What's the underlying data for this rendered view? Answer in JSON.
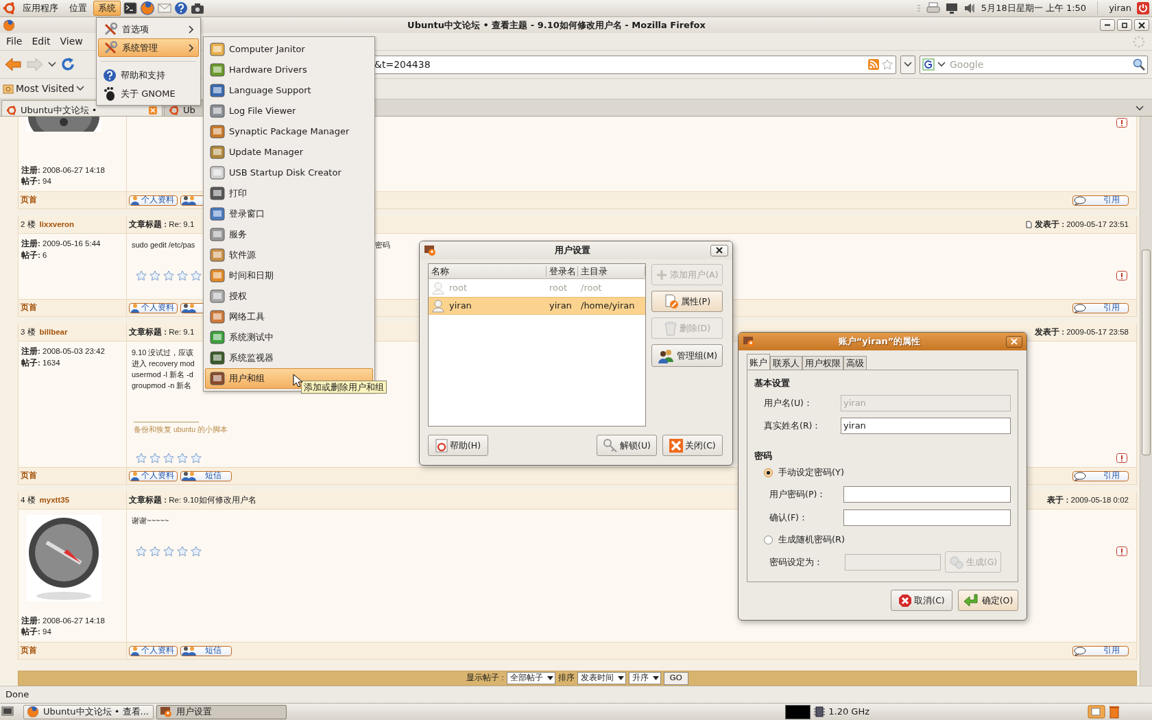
{
  "top_panel": {
    "menus": [
      {
        "label": "应用程序",
        "selected": false
      },
      {
        "label": "位置",
        "selected": false
      },
      {
        "label": "系统",
        "selected": true
      }
    ],
    "clock": "5月18日星期一 上午 1:50",
    "user": "yiran"
  },
  "browser": {
    "title": "Ubuntu中文论坛 • 查看主题 - 9.10如何修改用户名 - Mozilla Firefox",
    "menus": [
      "File",
      "Edit",
      "View"
    ],
    "url": "&t=204438",
    "search": {
      "placeholder": "Google"
    },
    "bookmarks": [
      "Most Visited"
    ],
    "tabs": [
      {
        "label": "Ubuntu中文论坛 •",
        "selected": true
      },
      {
        "label": "Ub",
        "selected": false
      }
    ],
    "status": "Done"
  },
  "forum": {
    "posts": [
      {
        "avatar": {
          "kind": "cut"
        },
        "registered": "**注册:** 2008-06-27 14:18",
        "count": "**帖子:** 94",
        "report": true,
        "footer": {
          "top_link": "页首",
          "buttons": [
            {
              "kind": "profile",
              "label": "个人资料"
            },
            {
              "kind": "pm"
            }
          ],
          "quote": "引用"
        }
      },
      {
        "header": {
          "floor": "2 楼",
          "author": "lixxveron",
          "subject": "**文章标题 :** Re: 9.1",
          "posted": "**发表于 :** 2009-05-17 23:51",
          "posted_icon": true
        },
        "registered": "**注册:** 2009-05-16 5:44",
        "count": "**帖子:** 6",
        "lines": [
          [
            "sudo gedit /etc/pas",
            "密码"
          ]
        ],
        "stars": 0,
        "report": true,
        "footer": {
          "top_link": "页首",
          "buttons": [
            {
              "kind": "profile",
              "label": "个人资料"
            },
            {
              "kind": "pm"
            }
          ],
          "quote": "引用"
        }
      },
      {
        "header": {
          "floor": "3 楼",
          "author": "billbear",
          "subject": "**文章标题 :** Re: 9.1",
          "posted": "**发表于 :** 2009-05-17 23:58",
          "posted_icon": false
        },
        "registered": "**注册:** 2008-05-03 23:42",
        "count": "**帖子:** 1634",
        "lines": [
          [
            "9.10 没试过，应该"
          ],
          [
            "进入 recovery mod"
          ],
          [
            "usermod -l 新名 -d"
          ],
          [
            "groupmod -n 新名"
          ]
        ],
        "signature": "备份和恢复 ubuntu 的小脚本",
        "stars": 0,
        "report": true,
        "footer": {
          "top_link": "页首",
          "buttons": [
            {
              "kind": "profile",
              "label": "个人资料"
            },
            {
              "kind": "pm",
              "label": "短信"
            }
          ],
          "quote": "引用"
        }
      },
      {
        "header": {
          "floor": "4 楼",
          "author": "myxtt35",
          "subject": "**文章标题 :** Re: 9.10如何修改用户名",
          "posted": "**表于 :** 2009-05-18 0:02",
          "posted_icon": false
        },
        "avatar": {
          "kind": "full"
        },
        "registered": "**注册:** 2008-06-27 14:18",
        "count": "**帖子:** 94",
        "lines": [
          [
            "谢谢~~~~~"
          ]
        ],
        "stars": 0,
        "report": true,
        "footer": {
          "top_link": "页首",
          "buttons": [
            {
              "kind": "profile",
              "label": "个人资料"
            },
            {
              "kind": "pm",
              "label": "短信"
            }
          ],
          "quote": "引用"
        }
      }
    ],
    "toolbar": {
      "show_label": "显示帖子 :",
      "show_value": "全部帖子",
      "sort_label": "排序",
      "sort_value": "发表时间",
      "order_value": "升序",
      "go": "GO"
    }
  },
  "system_menu": {
    "items": [
      {
        "kind": "item",
        "label": "首选项",
        "submenu": true,
        "selected": false
      },
      {
        "kind": "item",
        "label": "系统管理",
        "submenu": true,
        "selected": true
      },
      {
        "kind": "separator"
      },
      {
        "kind": "item",
        "label": "帮助和支持",
        "submenu": false,
        "selected": false
      },
      {
        "kind": "item",
        "label": "关于 GNOME",
        "submenu": false,
        "selected": false
      }
    ]
  },
  "admin_menu": {
    "items": [
      {
        "label": "Computer Janitor",
        "selected": false
      },
      {
        "label": "Hardware Drivers",
        "selected": false
      },
      {
        "label": "Language Support",
        "selected": false
      },
      {
        "label": "Log File Viewer",
        "selected": false
      },
      {
        "label": "Synaptic Package Manager",
        "selected": false
      },
      {
        "label": "Update Manager",
        "selected": false
      },
      {
        "label": "USB Startup Disk Creator",
        "selected": false
      },
      {
        "label": "打印",
        "selected": false
      },
      {
        "label": "登录窗口",
        "selected": false
      },
      {
        "label": "服务",
        "selected": false
      },
      {
        "label": "软件源",
        "selected": false
      },
      {
        "label": "时间和日期",
        "selected": false
      },
      {
        "label": "授权",
        "selected": false
      },
      {
        "label": "网络工具",
        "selected": false
      },
      {
        "label": "系统测试中",
        "selected": false
      },
      {
        "label": "系统监视器",
        "selected": false
      },
      {
        "label": "用户和组",
        "selected": true
      }
    ],
    "tooltip": "添加或删除用户和组"
  },
  "users_dialog": {
    "title": "用户设置",
    "columns": [
      "名称",
      "登录名",
      "主目录"
    ],
    "rows": [
      {
        "name": "root",
        "login": "root",
        "home": "/root",
        "disabled": true,
        "selected": false
      },
      {
        "name": "yiran",
        "login": "yiran",
        "home": "/home/yiran",
        "disabled": false,
        "selected": true
      }
    ],
    "side_buttons": [
      {
        "label": "添加用户(A)",
        "disabled": true
      },
      {
        "label": "属性(P)",
        "disabled": false
      },
      {
        "label": "删除(D)",
        "disabled": true
      },
      {
        "label": "管理组(M)",
        "disabled": false
      }
    ],
    "help": "帮助(H)",
    "unlock": "解锁(U)",
    "close": "关闭(C)"
  },
  "properties_dialog": {
    "title": "账户“yiran”的属性",
    "tabs": [
      {
        "label": "账户",
        "selected": true
      },
      {
        "label": "联系人",
        "selected": false
      },
      {
        "label": "用户权限",
        "selected": false
      },
      {
        "label": "高级",
        "selected": false
      }
    ],
    "basic_heading": "基本设置",
    "username": {
      "label": "用户名(U)：",
      "value": "yiran",
      "disabled": true
    },
    "realname": {
      "label": "真实姓名(R)：",
      "value": "yiran",
      "disabled": false
    },
    "password_heading": "密码",
    "manual": {
      "label": "手动设定密码(Y)",
      "checked": true
    },
    "password": {
      "label": "用户密码(P)："
    },
    "confirm": {
      "label": "确认(F)："
    },
    "random": {
      "label": "生成随机密码(R)",
      "checked": false
    },
    "generated": {
      "label": "密码设定为：",
      "disabled": true
    },
    "generate": {
      "label": "生成(G)",
      "disabled": true
    },
    "cancel": "取消(C)",
    "ok": "确定(O)"
  },
  "taskbar": {
    "tasks": [
      {
        "label": "Ubuntu中文论坛 • 查看...",
        "selected": false
      },
      {
        "label": "用户设置",
        "selected": true
      }
    ],
    "cpu": "1.20 GHz"
  }
}
